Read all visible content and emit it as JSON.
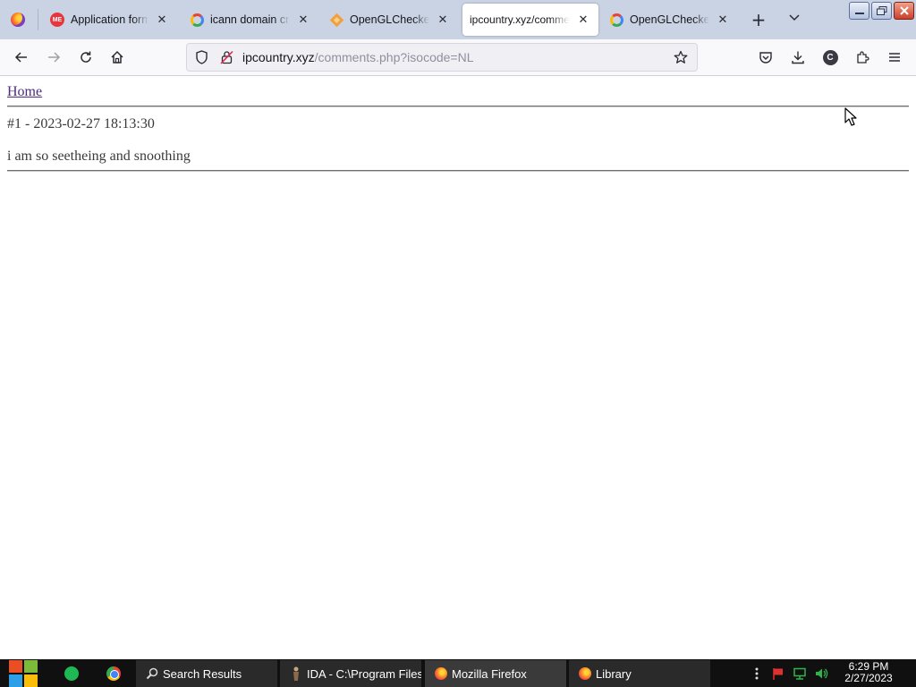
{
  "tabs": [
    {
      "label": "Application form",
      "icon": "me-icon",
      "active": false
    },
    {
      "label": "icann domain creation",
      "icon": "google-icon",
      "active": false
    },
    {
      "label": "OpenGLChecker download",
      "icon": "openglchecker-icon",
      "active": false
    },
    {
      "label": "ipcountry.xyz/comments.php",
      "icon": "none",
      "active": true
    },
    {
      "label": "OpenGLChecker download",
      "icon": "google-icon",
      "active": false
    }
  ],
  "navbar": {
    "url_host": "ipcountry.xyz",
    "url_path": "/comments.php?isocode=NL",
    "account_initial": "C"
  },
  "page": {
    "home_link": "Home",
    "comment_header": "#1 - 2023-02-27 18:13:30",
    "comment_body": "i am so seetheing and snoothing"
  },
  "taskbar": {
    "items": [
      {
        "label": "Search Results",
        "icon": "search-icon",
        "active": false
      },
      {
        "label": "IDA - C:\\Program Files\\",
        "icon": "ida-icon",
        "active": false
      },
      {
        "label": "Mozilla Firefox",
        "icon": "firefox-icon",
        "active": true
      },
      {
        "label": "Library",
        "icon": "firefox-icon",
        "active": false
      }
    ],
    "clock_time": "6:29 PM",
    "clock_date": "2/27/2023"
  },
  "colors": {
    "tabstrip": "#c9d3e3",
    "link_visited": "#4d2b7c",
    "taskbar": "#101010"
  }
}
